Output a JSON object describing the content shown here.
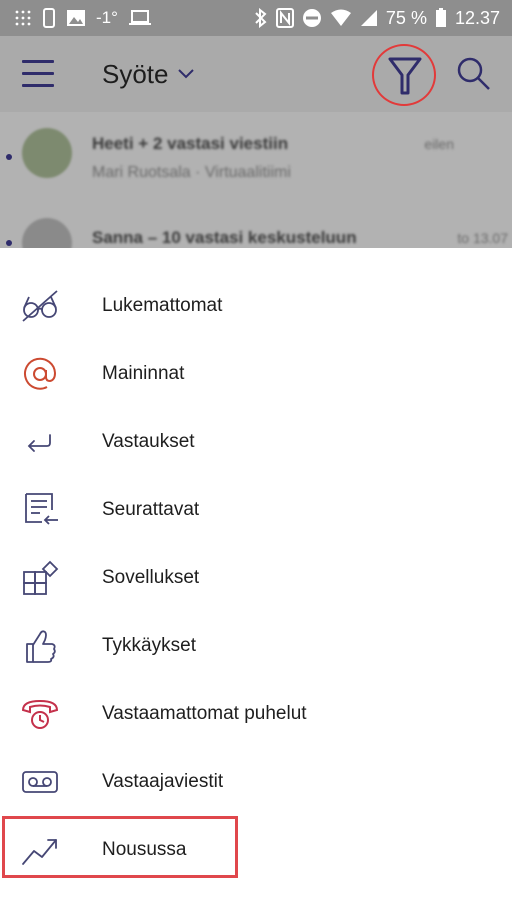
{
  "status_bar": {
    "temperature": "-1°",
    "battery": "75 %",
    "time": "12.37"
  },
  "header": {
    "title": "Syöte",
    "icons": [
      "hamburger-menu-icon",
      "chevron-down-icon",
      "filter-icon",
      "search-icon"
    ]
  },
  "feed": {
    "items": [
      {
        "title": "Heeti + 2 vastasi viestiin",
        "subtitle": "Mari Ruotsala · Virtuaalitiimi",
        "time": "eilen"
      },
      {
        "title": "Sanna – 10 vastasi keskusteluun",
        "subtitle": "",
        "time": "to 13.07"
      }
    ]
  },
  "filter_menu": {
    "items": [
      {
        "label": "Lukemattomat",
        "icon": "unread-glasses-icon"
      },
      {
        "label": "Maininnat",
        "icon": "at-mention-icon"
      },
      {
        "label": "Vastaukset",
        "icon": "reply-arrow-icon"
      },
      {
        "label": "Seurattavat",
        "icon": "followed-list-icon"
      },
      {
        "label": "Sovellukset",
        "icon": "apps-icon"
      },
      {
        "label": "Tykkäykset",
        "icon": "thumbs-up-icon"
      },
      {
        "label": "Vastaamattomat puhelut",
        "icon": "missed-call-icon"
      },
      {
        "label": "Vastaajaviestit",
        "icon": "voicemail-icon"
      },
      {
        "label": "Nousussa",
        "icon": "trending-up-icon"
      }
    ]
  },
  "colors": {
    "accent": "#464775",
    "mention": "#cc4a31",
    "missed_call": "#c4314b",
    "highlight_box": "#e0474c"
  }
}
